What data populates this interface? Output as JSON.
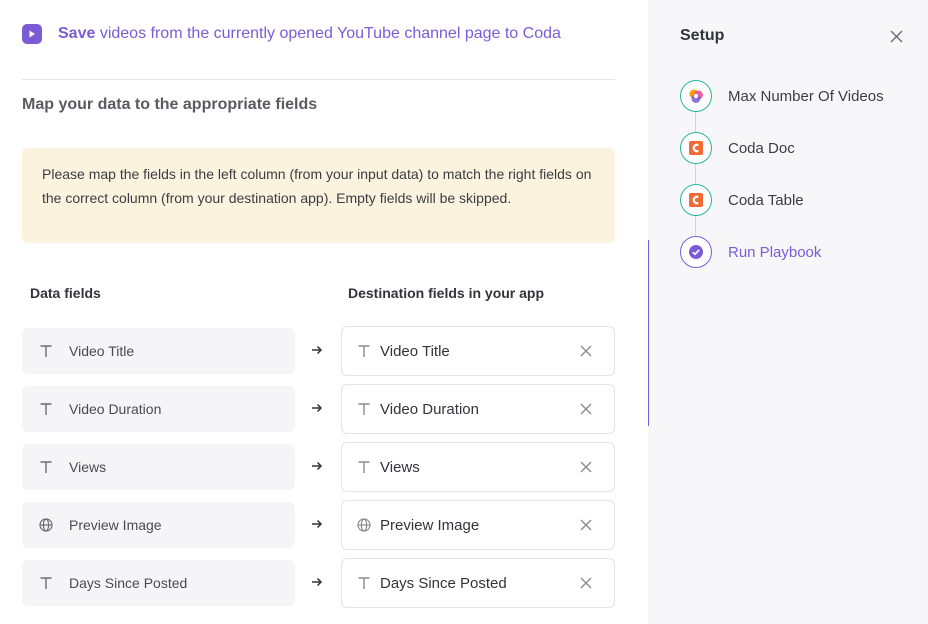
{
  "header": {
    "bold": "Save",
    "text": "videos from the currently opened YouTube channel page to Coda",
    "icon": "play-icon"
  },
  "section_title": "Map your data to the appropriate fields",
  "notice": "Please map the fields in the left column (from your input data) to match the right fields on the correct column (from your destination app). Empty fields will be skipped.",
  "columns": {
    "left": "Data fields",
    "right": "Destination fields in your app"
  },
  "rows": [
    {
      "source": "Video Title",
      "source_icon": "text-type-icon",
      "dest": "Video Title",
      "dest_icon": "text-type-icon"
    },
    {
      "source": "Video Duration",
      "source_icon": "text-type-icon",
      "dest": "Video Duration",
      "dest_icon": "text-type-icon"
    },
    {
      "source": "Views",
      "source_icon": "text-type-icon",
      "dest": "Views",
      "dest_icon": "text-type-icon"
    },
    {
      "source": "Preview Image",
      "source_icon": "globe-icon",
      "dest": "Preview Image",
      "dest_icon": "globe-icon"
    },
    {
      "source": "Days Since Posted",
      "source_icon": "text-type-icon",
      "dest": "Days Since Posted",
      "dest_icon": "text-type-icon"
    }
  ],
  "side": {
    "title": "Setup",
    "steps": [
      {
        "label": "Max Number Of Videos",
        "icon": "app-logo-icon"
      },
      {
        "label": "Coda Doc",
        "icon": "coda-icon"
      },
      {
        "label": "Coda Table",
        "icon": "coda-icon"
      },
      {
        "label": "Run Playbook",
        "icon": "check-circle-icon",
        "active": true
      }
    ]
  },
  "colors": {
    "accent": "#7b5cd6",
    "success": "#2bb39a",
    "coda": "#f46a35",
    "notice_bg": "#fcf3de"
  }
}
